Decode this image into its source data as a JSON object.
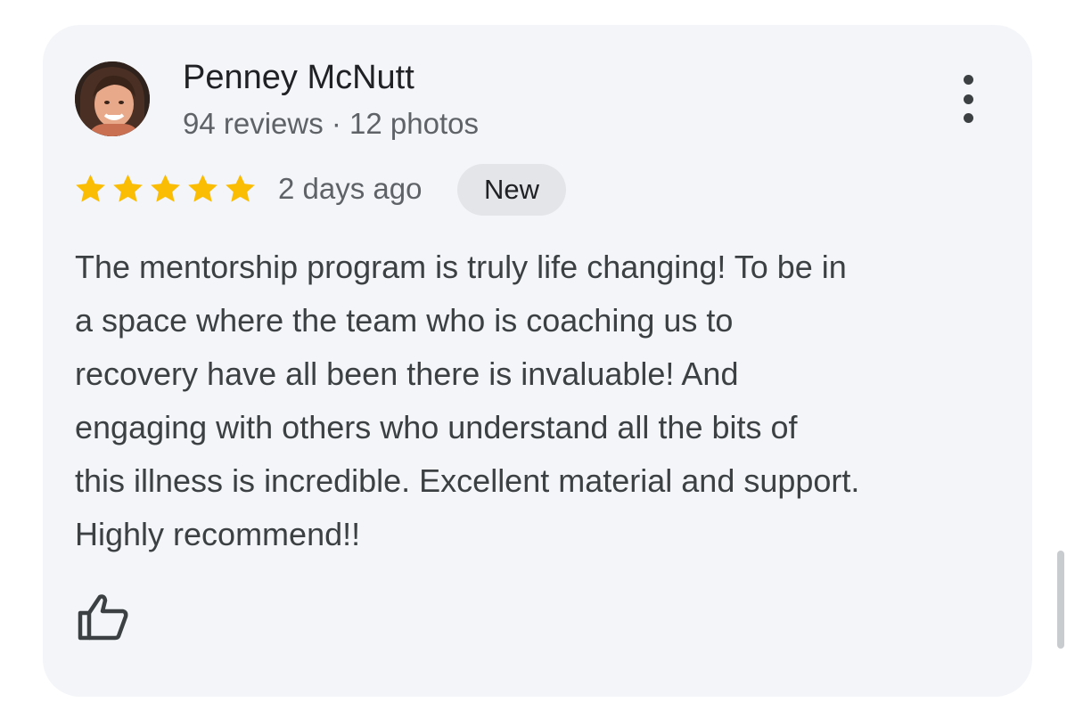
{
  "review": {
    "reviewer_name": "Penney McNutt",
    "reviewer_meta": "94 reviews · 12 photos",
    "rating_stars": 5,
    "rating_max": 5,
    "date": "2 days ago",
    "badge": "New",
    "text_lines": [
      "The mentorship program is truly life changing! To be in",
      "a space where the team who is coaching us to",
      "recovery have all been there is invaluable! And",
      "engaging with others who understand all the bits of",
      "this illness is incredible. Excellent material and support.",
      "Highly recommend!!"
    ]
  },
  "icons": {
    "avatar": "avatar-photo",
    "menu": "more-vert-icon",
    "star": "star-icon",
    "like": "thumb-up-icon"
  },
  "colors": {
    "star": "#fbbc04",
    "card_bg": "#f3f5f8",
    "badge_bg": "#e3e5e8"
  }
}
